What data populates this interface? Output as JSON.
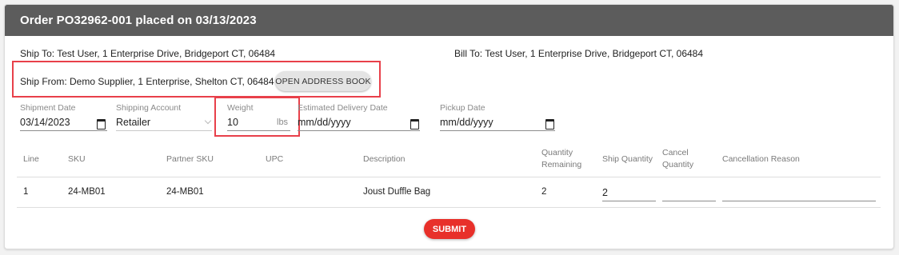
{
  "header": {
    "title": "Order PO32962-001 placed on 03/13/2023"
  },
  "addresses": {
    "ship_to": "Ship To: Test User, 1 Enterprise Drive, Bridgeport CT, 06484",
    "bill_to": "Bill To: Test User, 1 Enterprise Drive, Bridgeport CT, 06484",
    "ship_from": "Ship From: Demo Supplier, 1 Enterprise, Shelton CT, 06484",
    "address_book_button": "OPEN ADDRESS BOOK"
  },
  "fields": {
    "shipment_date": {
      "label": "Shipment Date",
      "value": "03/14/2023"
    },
    "shipping_account": {
      "label": "Shipping Account",
      "value": "Retailer"
    },
    "weight": {
      "label": "Weight",
      "value": "10",
      "unit": "lbs"
    },
    "estimated_delivery": {
      "label": "Estimated Delivery Date",
      "value": "mm/dd/yyyy"
    },
    "pickup_date": {
      "label": "Pickup Date",
      "value": "mm/dd/yyyy"
    }
  },
  "table": {
    "headers": {
      "line": "Line",
      "sku": "SKU",
      "partner_sku": "Partner SKU",
      "upc": "UPC",
      "description": "Description",
      "qty_remaining_1": "Quantity",
      "qty_remaining_2": "Remaining",
      "ship_quantity": "Ship Quantity",
      "cancel_quantity_1": "Cancel",
      "cancel_quantity_2": "Quantity",
      "cancellation_reason": "Cancellation Reason"
    },
    "rows": [
      {
        "line": "1",
        "sku": "24-MB01",
        "partner_sku": "24-MB01",
        "upc": "",
        "description": "Joust Duffle Bag",
        "quantity_remaining": "2",
        "ship_quantity": "2",
        "cancel_quantity": "",
        "cancellation_reason": ""
      }
    ]
  },
  "submit_label": "SUBMIT",
  "colors": {
    "header_bg": "#5c5c5c",
    "highlight": "#e8404a",
    "submit_bg": "#e8302a"
  }
}
